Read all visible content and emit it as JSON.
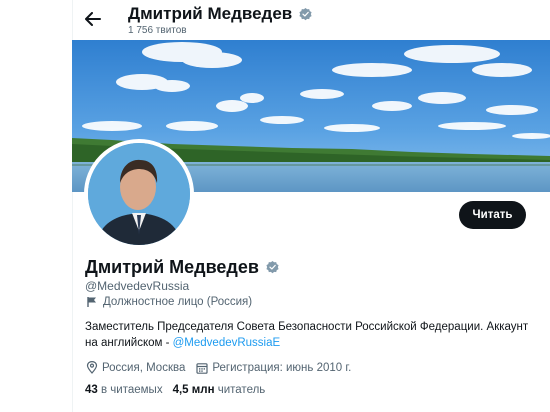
{
  "header": {
    "name": "Дмитрий Медведев",
    "tweet_count": "1 756 твитов"
  },
  "profile": {
    "follow_label": "Читать",
    "name": "Дмитрий Медведев",
    "handle": "@MedvedevRussia",
    "label": "Должностное лицо (Россия)",
    "bio_text": "Заместитель Председателя Совета Безопасности Российской Федерации. Аккаунт на английском - ",
    "bio_link": "@MedvedevRussiaE",
    "location": "Россия, Москва",
    "joined": "Регистрация: июнь 2010 г.",
    "following_count": "43",
    "following_label": "в читаемых",
    "followers_count": "4,5 млн",
    "followers_label": "читатель"
  },
  "icons": {
    "back": "arrow-left-icon",
    "verified": "verified-badge-icon",
    "label": "flag-icon",
    "location": "location-pin-icon",
    "joined": "calendar-icon"
  },
  "colors": {
    "accent": "#1d9bf0",
    "text": "#0f1419",
    "secondary": "#536471",
    "button": "#0f1419"
  }
}
